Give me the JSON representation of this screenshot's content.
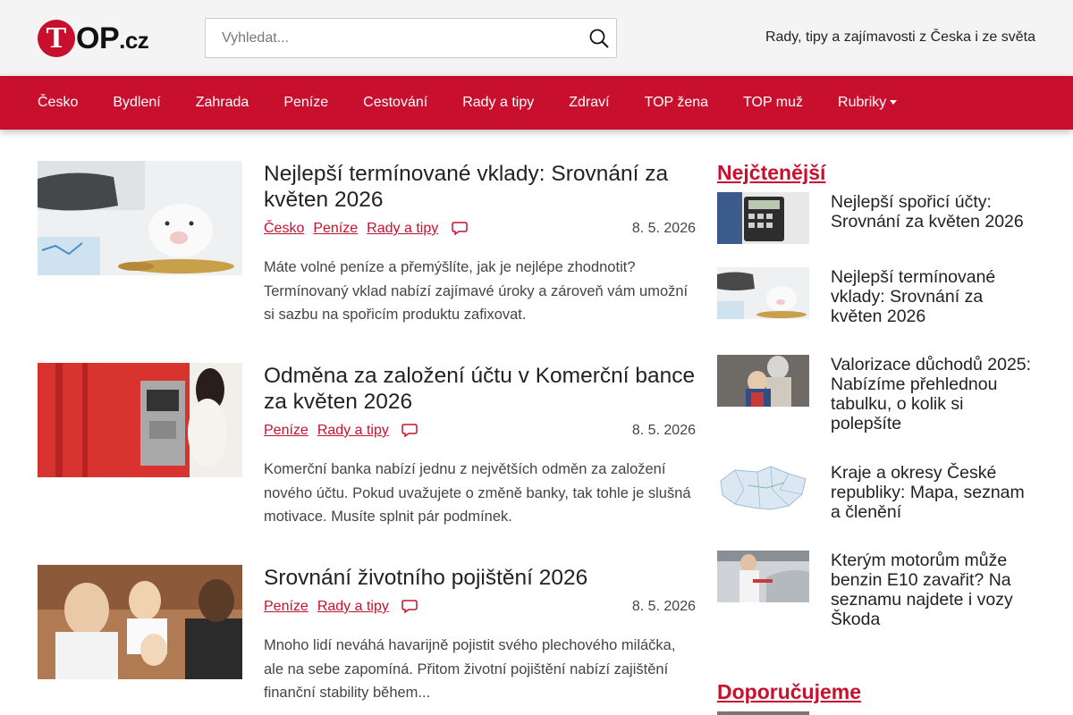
{
  "header": {
    "logo_letter": "T",
    "logo_text": "OP",
    "logo_tld": ".cz",
    "search_placeholder": "Vyhledat...",
    "tagline": "Rady, tipy a zajímavosti z Česka i ze světa"
  },
  "nav": {
    "items": [
      "Česko",
      "Bydlení",
      "Zahrada",
      "Peníze",
      "Cestování",
      "Rady a tipy",
      "Zdraví",
      "TOP žena",
      "TOP muž",
      "Rubriky"
    ]
  },
  "articles": [
    {
      "title": "Nejlepší termínované vklady: Srovnání za květen 2026",
      "tags": [
        "Česko",
        "Peníze",
        "Rady a tipy"
      ],
      "date": "8. 5. 2026",
      "excerpt": "Máte volné peníze a přemýšlíte, jak je nejlépe zhodnotit? Termínovaný vklad nabízí zajímavé úroky a zároveň vám umožní si sazbu na spořicím produktu zafixovat."
    },
    {
      "title": "Odměna za založení účtu v Komerční bance za květen 2026",
      "tags": [
        "Peníze",
        "Rady a tipy"
      ],
      "date": "8. 5. 2026",
      "excerpt": "Komerční banka nabízí jednu z největších odměn za založení nového účtu. Pokud uvažujete o změně banky, tak tohle je slušná motivace. Musíte splnit pár podmínek."
    },
    {
      "title": "Srovnání životního pojištění 2026",
      "tags": [
        "Peníze",
        "Rady a tipy"
      ],
      "date": "8. 5. 2026",
      "excerpt": "Mnoho lidí neváhá havarijně pojistit svého plechového miláčka, ale na sebe zapomíná. Přitom životní pojištění nabízí zajištění finanční stability během..."
    }
  ],
  "sidebar": {
    "most_read_title": "Nejčtenější",
    "most_read": [
      "Nejlepší spořicí účty: Srovnání za květen 2026",
      "Nejlepší termínované vklady: Srovnání za květen 2026",
      "Valorizace důchodů 2025: Nabízíme přehlednou tabulku, o kolik si polepšíte",
      "Kraje a okresy České republiky: Mapa, seznam a členění",
      "Kterým motorům může benzin E10 zavařit? Na seznamu najdete i vozy Škoda"
    ],
    "recommended_title": "Doporučujeme"
  },
  "colors": {
    "brand_red": "#c8102e",
    "header_bg": "#f4f4f4"
  }
}
